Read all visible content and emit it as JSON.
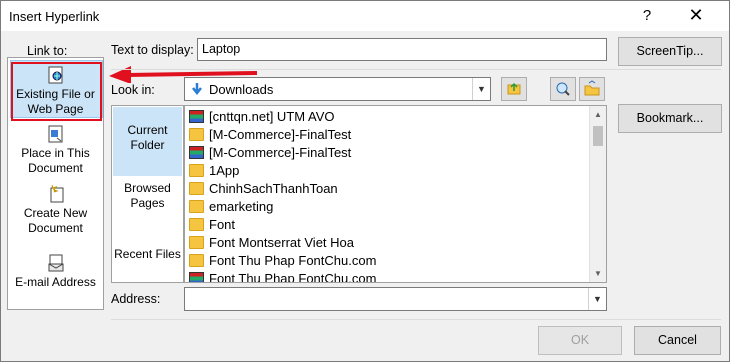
{
  "window": {
    "title": "Insert Hyperlink",
    "help_glyph": "?",
    "close_glyph": "✕"
  },
  "link_to": {
    "label": "Link to:",
    "items": [
      {
        "line1": "Existing File or",
        "line2": "Web Page",
        "icon": "web-page-icon"
      },
      {
        "line1": "Place in This",
        "line2": "Document",
        "icon": "document-place-icon"
      },
      {
        "line1": "Create New",
        "line2": "Document",
        "icon": "new-document-icon"
      },
      {
        "line1": "E-mail Address",
        "line2": "",
        "icon": "email-icon"
      }
    ]
  },
  "text_to_display": {
    "label": "Text to display:",
    "value": "Laptop"
  },
  "buttons": {
    "screentip": "ScreenTip...",
    "bookmark": "Bookmark...",
    "ok": "OK",
    "cancel": "Cancel"
  },
  "look_in": {
    "label": "Look in:",
    "value": "Downloads",
    "options": [
      {
        "line1": "Current",
        "line2": "Folder"
      },
      {
        "line1": "Browsed",
        "line2": "Pages"
      },
      {
        "line1": "Recent Files",
        "line2": ""
      }
    ]
  },
  "files": [
    {
      "name": "[cnttqn.net] UTM AVO",
      "type": "rar"
    },
    {
      "name": "[M-Commerce]-FinalTest",
      "type": "folder"
    },
    {
      "name": "[M-Commerce]-FinalTest",
      "type": "rar"
    },
    {
      "name": "1App",
      "type": "folder"
    },
    {
      "name": "ChinhSachThanhToan",
      "type": "folder"
    },
    {
      "name": "emarketing",
      "type": "folder"
    },
    {
      "name": "Font",
      "type": "folder"
    },
    {
      "name": "Font Montserrat Viet Hoa",
      "type": "folder"
    },
    {
      "name": "Font Thu Phap FontChu.com",
      "type": "folder"
    },
    {
      "name": "Font Thu Phap FontChu.com",
      "type": "rar"
    }
  ],
  "address": {
    "label": "Address:",
    "value": ""
  },
  "colors": {
    "highlight": "#cce4f7",
    "annotation_red": "#e0101f"
  }
}
